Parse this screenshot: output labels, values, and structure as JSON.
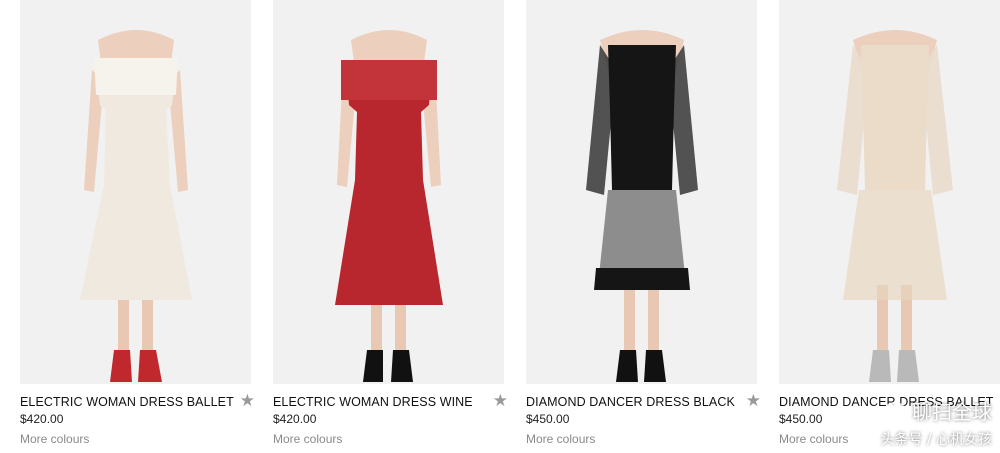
{
  "products": [
    {
      "title": "ELECTRIC WOMAN DRESS BALLET",
      "price": "$420.00",
      "more": "More colours",
      "dress_color": "#efe9e0",
      "shoe_color": "#c0282e"
    },
    {
      "title": "ELECTRIC WOMAN DRESS WINE",
      "price": "$420.00",
      "more": "More colours",
      "dress_color": "#b8262e",
      "shoe_color": "#111111"
    },
    {
      "title": "DIAMOND DANCER DRESS BLACK",
      "price": "$450.00",
      "more": "More colours",
      "dress_color": "#151515",
      "shoe_color": "#111111"
    },
    {
      "title": "DIAMOND DANCER DRESS BALLET",
      "price": "$450.00",
      "more": "More colours",
      "dress_color": "#eadcc8",
      "shoe_color": "#b9b9b9"
    }
  ],
  "watermark": {
    "line1": "聊扫全球",
    "line2": "头条号 / 心机女孩"
  },
  "icons": {
    "favorite": "star-icon"
  }
}
